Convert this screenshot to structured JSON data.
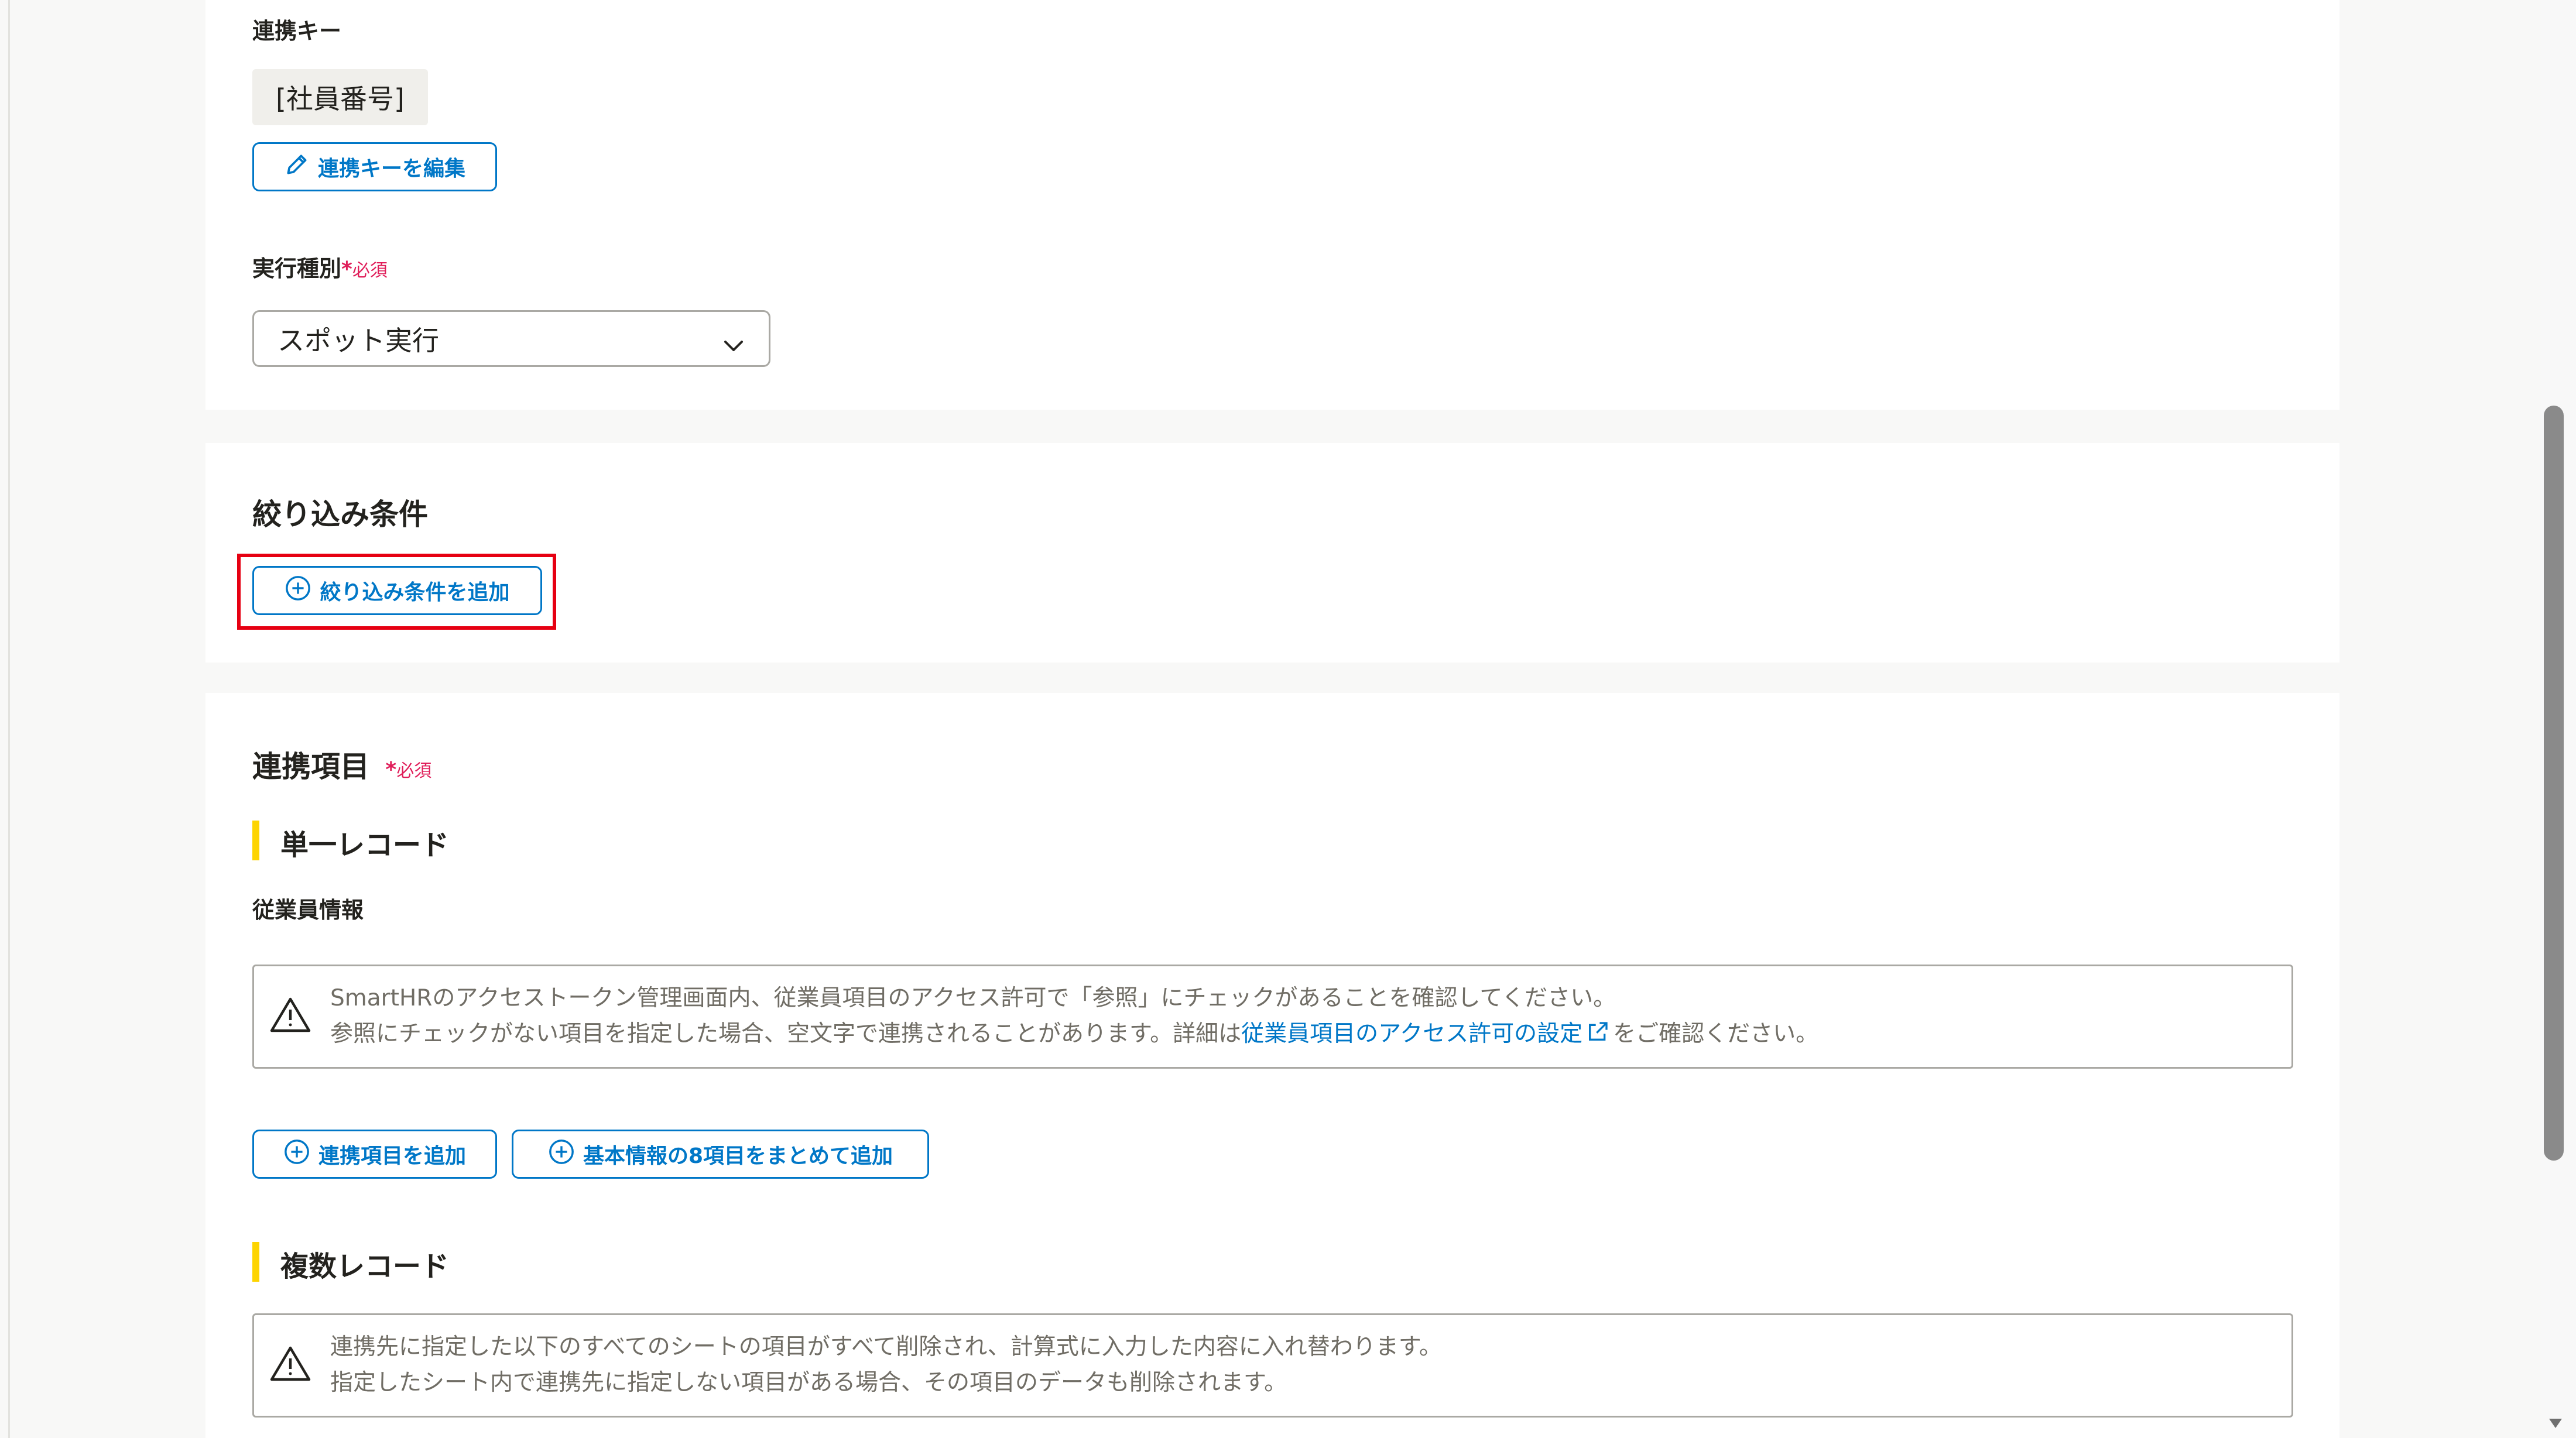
{
  "sync_settings": {
    "sync_key_label": "連携キー",
    "sync_key_value": "[社員番号]",
    "edit_sync_key_button": "連携キーを編集",
    "execution_type_label": "実行種別",
    "required_star": "*",
    "required_text": "必須",
    "execution_type_value": "スポット実行"
  },
  "filter": {
    "title": "絞り込み条件",
    "add_button": "絞り込み条件を追加"
  },
  "sync_items": {
    "title": "連携項目",
    "required_star": "*",
    "required_text": "必須",
    "single_record": {
      "heading": "単一レコード",
      "group_label": "従業員情報",
      "alert_line1": "SmartHRのアクセストークン管理画面内、従業員項目のアクセス許可で「参照」にチェックがあることを確認してください。",
      "alert_line2_prefix": "参照にチェックがない項目を指定した場合、空文字で連携されることがあります。詳細は",
      "alert_link": "従業員項目のアクセス許可の設定",
      "alert_line2_suffix": "をご確認ください。",
      "add_item_button": "連携項目を追加",
      "add_basic_button": "基本情報の8項目をまとめて追加"
    },
    "multi_record": {
      "heading": "複数レコード",
      "alert_line1": "連携先に指定した以下のすべてのシートの項目がすべて削除され、計算式に入力した内容に入れ替わります。",
      "alert_line2": "指定したシート内で連携先に指定しない項目がある場合、その項目のデータも削除されます。"
    }
  },
  "colors": {
    "accent": "#0077c7",
    "required": "#e01e5a",
    "highlight": "#e60012",
    "heading_bar": "#fdd400"
  }
}
